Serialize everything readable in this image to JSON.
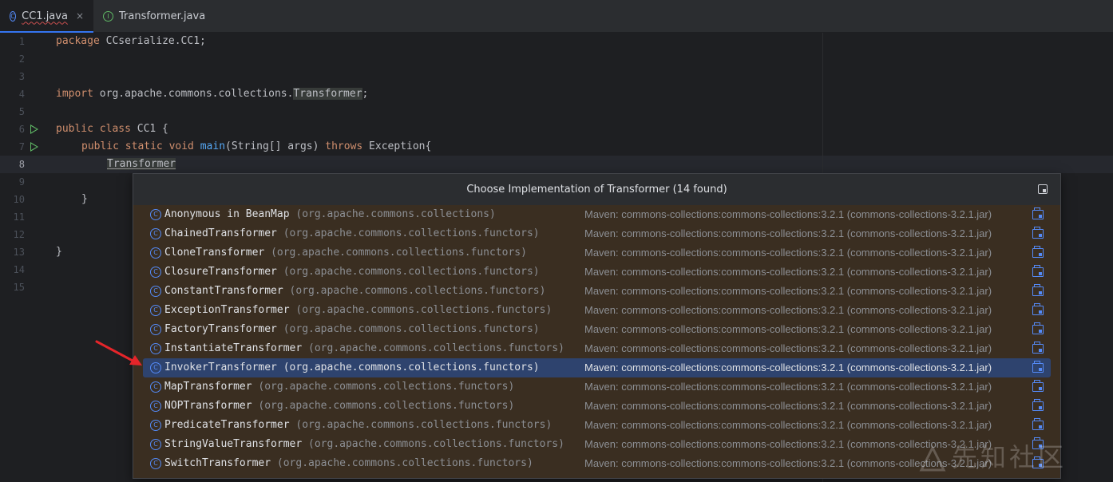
{
  "tabs": [
    {
      "label": "CC1.java",
      "icon": "class-icon",
      "active": true,
      "close": "×"
    },
    {
      "label": "Transformer.java",
      "icon": "interface-icon",
      "active": false
    }
  ],
  "editor": {
    "line_numbers": [
      "1",
      "2",
      "3",
      "4",
      "5",
      "6",
      "7",
      "8",
      "9",
      "10",
      "11",
      "12",
      "13",
      "14",
      "15"
    ],
    "current_line": "8",
    "lines": {
      "l1_kw": "package",
      "l1_rest": " CCserialize.CC1;",
      "l4_kw": "import",
      "l4_rest": " org.apache.commons.collections.",
      "l4_hl": "Transformer",
      "l4_end": ";",
      "l6_kw": "public class",
      "l6_rest": " CC1 {",
      "l7_kw1": "public static void",
      "l7_fn": "main",
      "l7_rest": "(String[] args) ",
      "l7_kw2": "throws",
      "l7_end": " Exception{",
      "l8_text": "Transformer",
      "l10_text": "}",
      "l13_text": "}"
    }
  },
  "popup": {
    "title": "Choose Implementation of Transformer (14 found)",
    "items": [
      {
        "name": "Anonymous in BeanMap",
        "pkg": "(org.apache.commons.collections)",
        "maven": "Maven: commons-collections:commons-collections:3.2.1 (commons-collections-3.2.1.jar)"
      },
      {
        "name": "ChainedTransformer",
        "pkg": "(org.apache.commons.collections.functors)",
        "maven": "Maven: commons-collections:commons-collections:3.2.1 (commons-collections-3.2.1.jar)"
      },
      {
        "name": "CloneTransformer",
        "pkg": "(org.apache.commons.collections.functors)",
        "maven": "Maven: commons-collections:commons-collections:3.2.1 (commons-collections-3.2.1.jar)"
      },
      {
        "name": "ClosureTransformer",
        "pkg": "(org.apache.commons.collections.functors)",
        "maven": "Maven: commons-collections:commons-collections:3.2.1 (commons-collections-3.2.1.jar)"
      },
      {
        "name": "ConstantTransformer",
        "pkg": "(org.apache.commons.collections.functors)",
        "maven": "Maven: commons-collections:commons-collections:3.2.1 (commons-collections-3.2.1.jar)"
      },
      {
        "name": "ExceptionTransformer",
        "pkg": "(org.apache.commons.collections.functors)",
        "maven": "Maven: commons-collections:commons-collections:3.2.1 (commons-collections-3.2.1.jar)"
      },
      {
        "name": "FactoryTransformer",
        "pkg": "(org.apache.commons.collections.functors)",
        "maven": "Maven: commons-collections:commons-collections:3.2.1 (commons-collections-3.2.1.jar)"
      },
      {
        "name": "InstantiateTransformer",
        "pkg": "(org.apache.commons.collections.functors)",
        "maven": "Maven: commons-collections:commons-collections:3.2.1 (commons-collections-3.2.1.jar)"
      },
      {
        "name": "InvokerTransformer",
        "pkg": "(org.apache.commons.collections.functors)",
        "maven": "Maven: commons-collections:commons-collections:3.2.1 (commons-collections-3.2.1.jar)",
        "selected": true
      },
      {
        "name": "MapTransformer",
        "pkg": "(org.apache.commons.collections.functors)",
        "maven": "Maven: commons-collections:commons-collections:3.2.1 (commons-collections-3.2.1.jar)"
      },
      {
        "name": "NOPTransformer",
        "pkg": "(org.apache.commons.collections.functors)",
        "maven": "Maven: commons-collections:commons-collections:3.2.1 (commons-collections-3.2.1.jar)"
      },
      {
        "name": "PredicateTransformer",
        "pkg": "(org.apache.commons.collections.functors)",
        "maven": "Maven: commons-collections:commons-collections:3.2.1 (commons-collections-3.2.1.jar)"
      },
      {
        "name": "StringValueTransformer",
        "pkg": "(org.apache.commons.collections.functors)",
        "maven": "Maven: commons-collections:commons-collections:3.2.1 (commons-collections-3.2.1.jar)"
      },
      {
        "name": "SwitchTransformer",
        "pkg": "(org.apache.commons.collections.functors)",
        "maven": "Maven: commons-collections:commons-collections:3.2.1 (commons-collections-3.2.1.jar)"
      }
    ]
  },
  "watermark": {
    "text": "先知社区"
  },
  "colors": {
    "accent": "#3574f0",
    "selection": "#2e436e",
    "popup_bg": "#3a2e21",
    "arrow": "#e5252a"
  }
}
